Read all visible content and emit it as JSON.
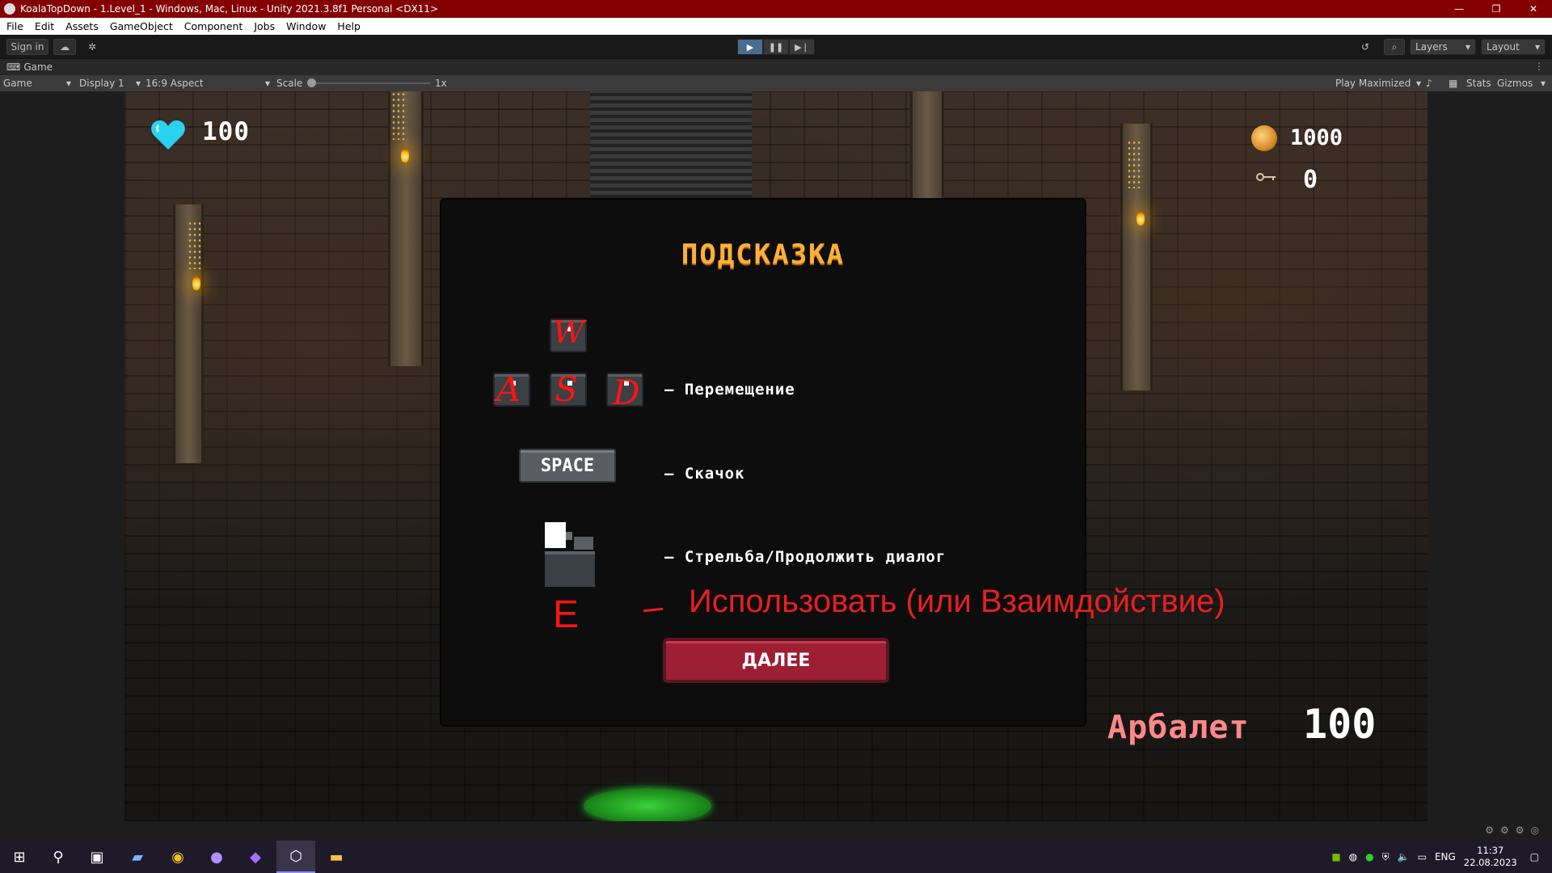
{
  "window": {
    "title": "KoalaTopDown - 1.Level_1 - Windows, Mac, Linux - Unity 2021.3.8f1 Personal <DX11>",
    "minimize": "—",
    "restore": "❐",
    "close": "✕"
  },
  "menu": [
    "File",
    "Edit",
    "Assets",
    "GameObject",
    "Component",
    "Jobs",
    "Window",
    "Help"
  ],
  "toolbar": {
    "sign_in": "Sign in",
    "layers": "Layers",
    "layout": "Layout"
  },
  "tab": {
    "label": "Game"
  },
  "gamebar": {
    "mode": "Game",
    "display": "Display 1",
    "aspect": "16:9 Aspect",
    "scale_label": "Scale",
    "scale_value": "1x",
    "play_mode": "Play Maximized",
    "stats": "Stats",
    "gizmos": "Gizmos"
  },
  "hud": {
    "hp": "100",
    "coins": "1000",
    "keys": "0",
    "weapon": "Арбалет",
    "ammo": "100"
  },
  "dialog": {
    "title": "ПОДСКАЗКА",
    "key_w": "W",
    "key_a": "A",
    "key_s": "S",
    "key_d": "D",
    "key_e": "E",
    "space": "SPACE",
    "move": "– Перемещение",
    "jump": "– Скачок",
    "shoot": "– Стрельба/Продолжить диалог",
    "use": "Использовать (или Взаимдойствие)",
    "next": "ДАЛЕЕ"
  },
  "taskbar": {
    "lang": "ENG",
    "time": "11:37",
    "date": "22.08.2023"
  },
  "colors": {
    "title_bar": "#840000",
    "dialog_title": "#ffb037",
    "next_button": "#9e1f32",
    "annotation_red": "#e81f1f",
    "heart": "#29d3f0"
  }
}
